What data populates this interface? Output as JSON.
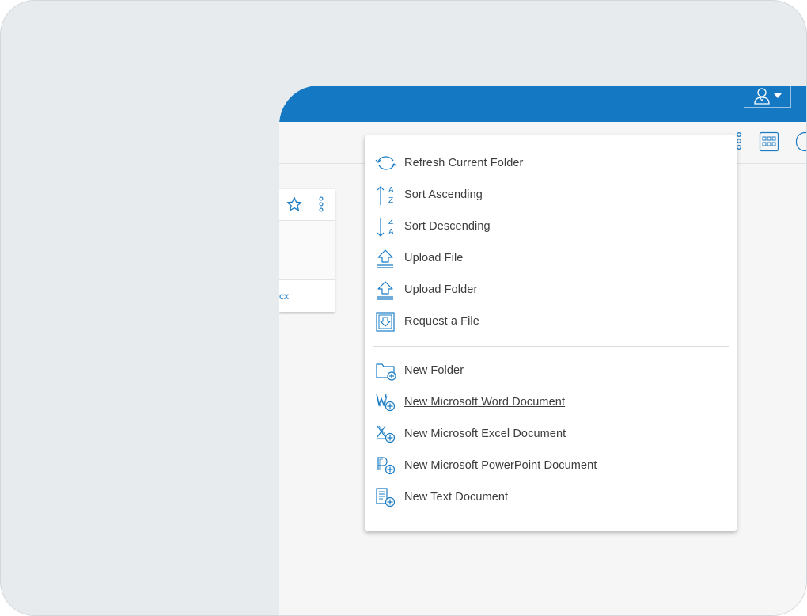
{
  "header": {
    "user_menu_icon": "user-avatar-icon",
    "user_menu_caret": "caret-down-icon"
  },
  "toolbar": {
    "more_icon": "vertical-ellipsis-icon",
    "grid_view_icon": "grid-view-icon",
    "info_icon": "info-panel-icon"
  },
  "file_card": {
    "star_icon": "star-outline-icon",
    "more_icon": "vertical-ellipsis-icon",
    "filename_fragment": "cx"
  },
  "context_menu": {
    "groups": [
      {
        "items": [
          {
            "label": "Refresh Current Folder",
            "icon": "refresh-icon"
          },
          {
            "label": "Sort Ascending",
            "icon": "sort-ascending-icon"
          },
          {
            "label": "Sort Descending",
            "icon": "sort-descending-icon"
          },
          {
            "label": "Upload File",
            "icon": "upload-file-icon"
          },
          {
            "label": "Upload Folder",
            "icon": "upload-folder-icon"
          },
          {
            "label": "Request a File",
            "icon": "request-file-icon"
          }
        ]
      },
      {
        "items": [
          {
            "label": "New Folder",
            "icon": "new-folder-icon"
          },
          {
            "label": "New Microsoft Word Document",
            "icon": "new-word-document-icon",
            "state": "hovered"
          },
          {
            "label": "New Microsoft Excel Document",
            "icon": "new-excel-document-icon"
          },
          {
            "label": "New Microsoft PowerPoint Document",
            "icon": "new-powerpoint-document-icon"
          },
          {
            "label": "New Text Document",
            "icon": "new-text-document-icon"
          }
        ]
      }
    ]
  },
  "colors": {
    "brand_blue": "#1578c3",
    "icon_blue": "#1a7bc4",
    "menu_text": "#3d3d3d",
    "background": "#e8ebee"
  }
}
